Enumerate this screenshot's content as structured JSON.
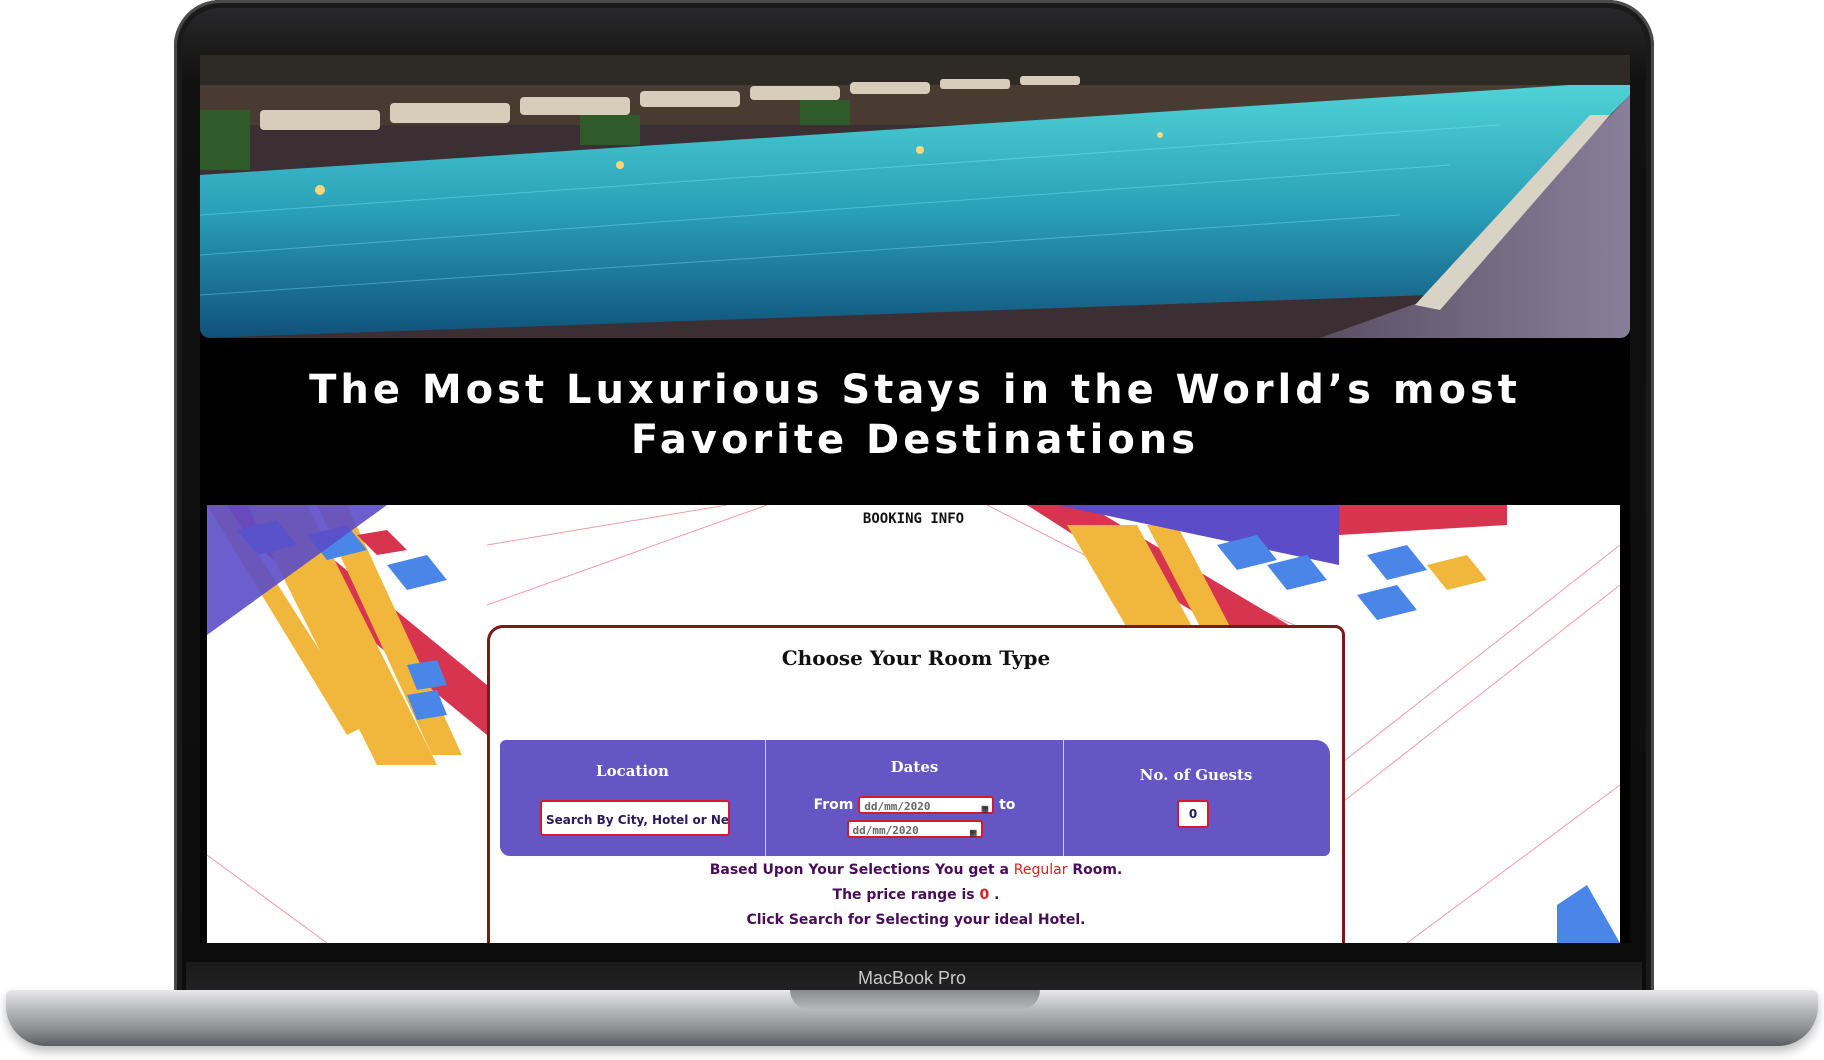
{
  "device": {
    "brand": "MacBook Pro"
  },
  "page": {
    "tagline": "The Most Luxurious Stays in the World’s most Favorite Destinations",
    "booking_heading": "BOOKING INFO",
    "card_title": "Choose Your Room Type",
    "filters": {
      "location_label": "Location",
      "location_placeholder": "Search By City, Hotel or Neighbc",
      "dates_label": "Dates",
      "from_label": "From",
      "to_label": "to",
      "date_from_placeholder": "dd/mm/2020",
      "date_to_placeholder": "dd/mm/2020",
      "guests_label": "No. of Guests",
      "guests_value": "0"
    },
    "result": {
      "line1_prefix": "Based Upon Your Selections You get a",
      "room_type": "Regular",
      "line1_suffix": "Room.",
      "line2_prefix": "The price range is",
      "price": "0",
      "line2_suffix": ".",
      "line3": "Click Search for Selecting your ideal Hotel."
    }
  },
  "colors": {
    "filter_bar": "#6556c4",
    "accent_red": "#e01e1e",
    "card_border": "#7a1a1a",
    "message_text": "#4a0d5a"
  }
}
